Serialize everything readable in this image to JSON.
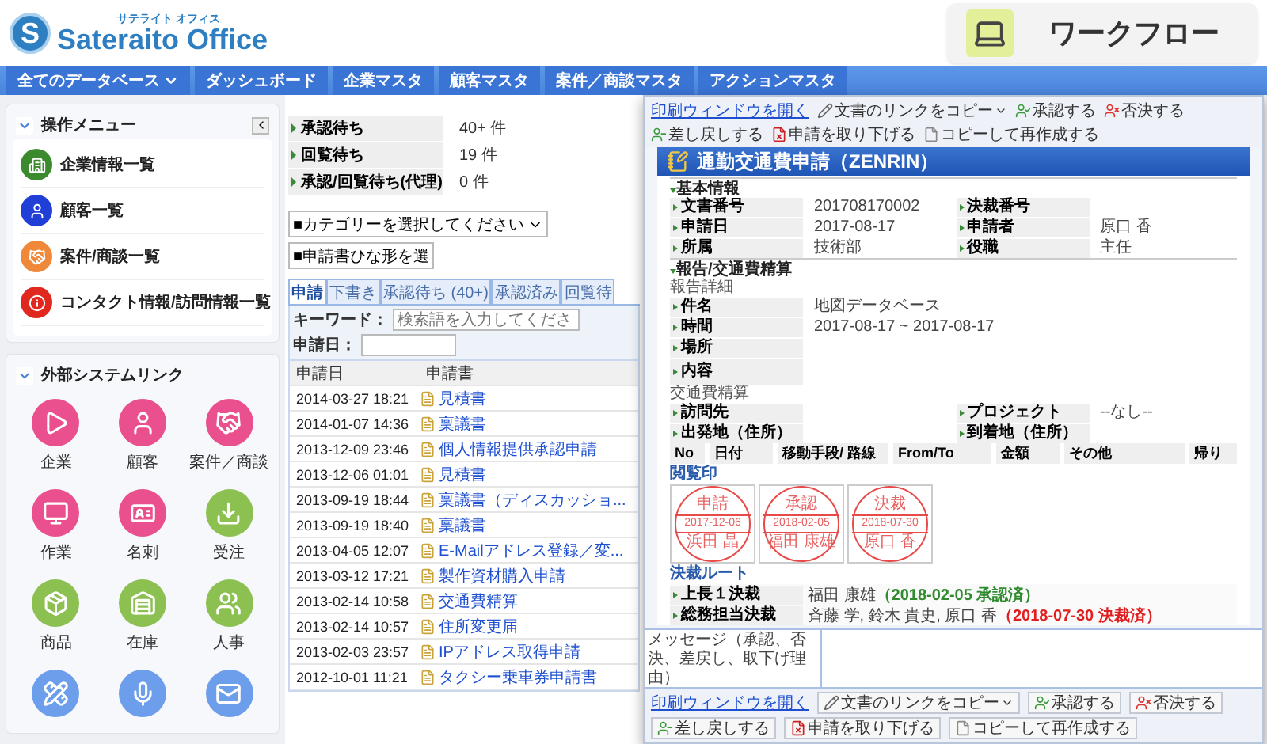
{
  "header": {
    "logo": {
      "mark": "S",
      "ruby": "サテライト オフィス",
      "name": "Sateraito Office"
    },
    "app": {
      "title": "ワークフロー"
    }
  },
  "nav": [
    {
      "label": "全てのデータベース",
      "dropdown": true
    },
    {
      "label": "ダッシュボード",
      "dropdown": false
    },
    {
      "label": "企業マスタ",
      "dropdown": false
    },
    {
      "label": "顧客マスタ",
      "dropdown": false
    },
    {
      "label": "案件／商談マスタ",
      "dropdown": false
    },
    {
      "label": "アクションマスタ",
      "dropdown": false
    }
  ],
  "sidebar": {
    "menu": {
      "title": "操作メニュー",
      "items": [
        {
          "kind": "building",
          "label": "企業情報一覧",
          "color": "#3c8a2e"
        },
        {
          "kind": "person",
          "label": "顧客一覧",
          "color": "#1f3fd6"
        },
        {
          "kind": "handshake",
          "label": "案件/商談一覧",
          "color": "#f0883a"
        },
        {
          "kind": "info",
          "label": "コンタクト情報/訪問情報一覧",
          "color": "#e0281e"
        }
      ]
    },
    "links": {
      "title": "外部システムリンク",
      "items": [
        {
          "kind": "play",
          "label": "企業",
          "color": "#e9508d"
        },
        {
          "kind": "person",
          "label": "顧客",
          "color": "#e9508d"
        },
        {
          "kind": "handshake",
          "label": "案件／商談",
          "color": "#e9508d"
        },
        {
          "kind": "monitor",
          "label": "作業",
          "color": "#e9508d"
        },
        {
          "kind": "card",
          "label": "名刺",
          "color": "#e9508d"
        },
        {
          "kind": "download",
          "label": "受注",
          "color": "#8cc152"
        },
        {
          "kind": "package",
          "label": "商品",
          "color": "#8cc152"
        },
        {
          "kind": "warehouse",
          "label": "在庫",
          "color": "#8cc152"
        },
        {
          "kind": "users",
          "label": "人事",
          "color": "#8cc152"
        },
        {
          "kind": "pencils",
          "color": "#6d9eeb"
        },
        {
          "kind": "mic",
          "color": "#6d9eeb"
        },
        {
          "kind": "mail",
          "color": "#6d9eeb"
        }
      ]
    }
  },
  "summary": [
    {
      "label": "承認待ち",
      "value": "40+ 件"
    },
    {
      "label": "回覧待ち",
      "value": "19 件"
    },
    {
      "label": "承認/回覧待ち(代理)",
      "value": "0 件"
    }
  ],
  "filters": {
    "category": "■カテゴリーを選択してください",
    "template": "■申請書ひな形を選"
  },
  "tabs": [
    {
      "label": "申請",
      "selected": true
    },
    {
      "label": "下書き",
      "selected": false
    },
    {
      "label": "承認待ち (40+)",
      "selected": false
    },
    {
      "label": "承認済み",
      "selected": false
    },
    {
      "label": "回覧待",
      "selected": false
    }
  ],
  "search": {
    "keyword_label": "キーワード：",
    "keyword_placeholder": "検索語を入力してくださ",
    "date_label": "申請日："
  },
  "table": {
    "columns": [
      "申請日",
      "申請書"
    ],
    "rows": [
      {
        "date": "2014-03-27 18:21",
        "document": "見積書"
      },
      {
        "date": "2014-01-07 14:36",
        "document": "稟議書"
      },
      {
        "date": "2013-12-09 23:46",
        "document": "個人情報提供承認申請"
      },
      {
        "date": "2013-12-06 01:01",
        "document": "見積書"
      },
      {
        "date": "2013-09-19 18:44",
        "document": "稟議書（ディスカッショ..."
      },
      {
        "date": "2013-09-19 18:40",
        "document": "稟議書"
      },
      {
        "date": "2013-04-05 12:07",
        "document": "E-Mailアドレス登録／変..."
      },
      {
        "date": "2013-03-12 17:21",
        "document": "製作資材購入申請"
      },
      {
        "date": "2013-02-14 10:58",
        "document": "交通費精算"
      },
      {
        "date": "2013-02-14 10:57",
        "document": "住所変更届"
      },
      {
        "date": "2013-02-03 23:57",
        "document": "IPアドレス取得申請"
      },
      {
        "date": "2012-10-01 11:21",
        "document": "タクシー乗車券申請書"
      }
    ]
  },
  "popup": {
    "top_toolbar": {
      "print_link": "印刷ウィンドウを開く",
      "actions": [
        {
          "kind": "copy-link",
          "label": "文書のリンクをコピー",
          "dropdown": true
        },
        {
          "kind": "approve",
          "label": "承認する",
          "dropdown": false
        },
        {
          "kind": "reject",
          "label": "否決する",
          "dropdown": false
        },
        {
          "kind": "return",
          "label": "差し戻しする",
          "dropdown": false
        },
        {
          "kind": "withdraw",
          "label": "申請を取り下げる",
          "dropdown": false
        },
        {
          "kind": "duplicate",
          "label": "コピーして再作成する",
          "dropdown": false
        }
      ]
    },
    "title": "通勤交通費申請（ZENRIN）",
    "basic": {
      "heading": "基本情報",
      "fields": [
        {
          "label": "文書番号",
          "value": "201708170002"
        },
        {
          "label": "決裁番号"
        },
        {
          "label": "申請日",
          "value": "2017-08-17"
        },
        {
          "label": "申請者",
          "value": "原口 香"
        },
        {
          "label": "所属",
          "value": "技術部"
        },
        {
          "label": "役職",
          "value": "主任"
        }
      ]
    },
    "report": {
      "heading": "報告/交通費精算",
      "detail_heading": "報告詳細",
      "detail_fields": [
        {
          "label": "件名",
          "value": "地図データベース"
        },
        {
          "label": "時間",
          "value": "2017-08-17 ~ 2017-08-17"
        },
        {
          "label": "場所"
        },
        {
          "label": "内容"
        }
      ],
      "expense_heading": "交通費精算",
      "expense_fields": [
        {
          "label": "訪問先"
        },
        {
          "label": "プロジェクト",
          "value": "--なし--"
        },
        {
          "label": "出発地（住所）"
        },
        {
          "label": "到着地（住所）"
        }
      ],
      "expense_columns": [
        "No",
        "日付",
        "移動手段/ 路線",
        "From/To",
        "金額",
        "その他",
        "帰り"
      ]
    },
    "stamps": {
      "heading": "閲覧印",
      "items": [
        {
          "role": "申請",
          "date": "2017-12-06",
          "name": "浜田 晶"
        },
        {
          "role": "承認",
          "date": "2018-02-05",
          "name": "福田 康雄"
        },
        {
          "role": "決裁",
          "date": "2018-07-30",
          "name": "原口 香"
        }
      ]
    },
    "route": {
      "heading": "決裁ルート",
      "steps": [
        {
          "label": "上長１決裁",
          "approvers": "福田 康雄",
          "status": "（2018-02-05 承認済）",
          "kind": "approved"
        },
        {
          "label": "総務担当決裁",
          "approvers": "斉藤 学, 鈴木 貴史, 原口 香",
          "status": "（2018-07-30 決裁済）",
          "kind": "decided"
        }
      ]
    },
    "message": {
      "label": "メッセージ（承認、否決、差戻し、取下げ理由）"
    },
    "bottom_toolbar": {
      "print_link": "印刷ウィンドウを開く",
      "actions": [
        {
          "kind": "copy-link",
          "label": "文書のリンクをコピー",
          "dropdown": true
        },
        {
          "kind": "approve",
          "label": "承認する",
          "dropdown": false
        },
        {
          "kind": "reject",
          "label": "否決する",
          "dropdown": false
        },
        {
          "kind": "return",
          "label": "差し戻しする",
          "dropdown": false
        },
        {
          "kind": "withdraw",
          "label": "申請を取り下げる",
          "dropdown": false
        },
        {
          "kind": "duplicate",
          "label": "コピーして再作成する",
          "dropdown": false
        }
      ]
    }
  }
}
